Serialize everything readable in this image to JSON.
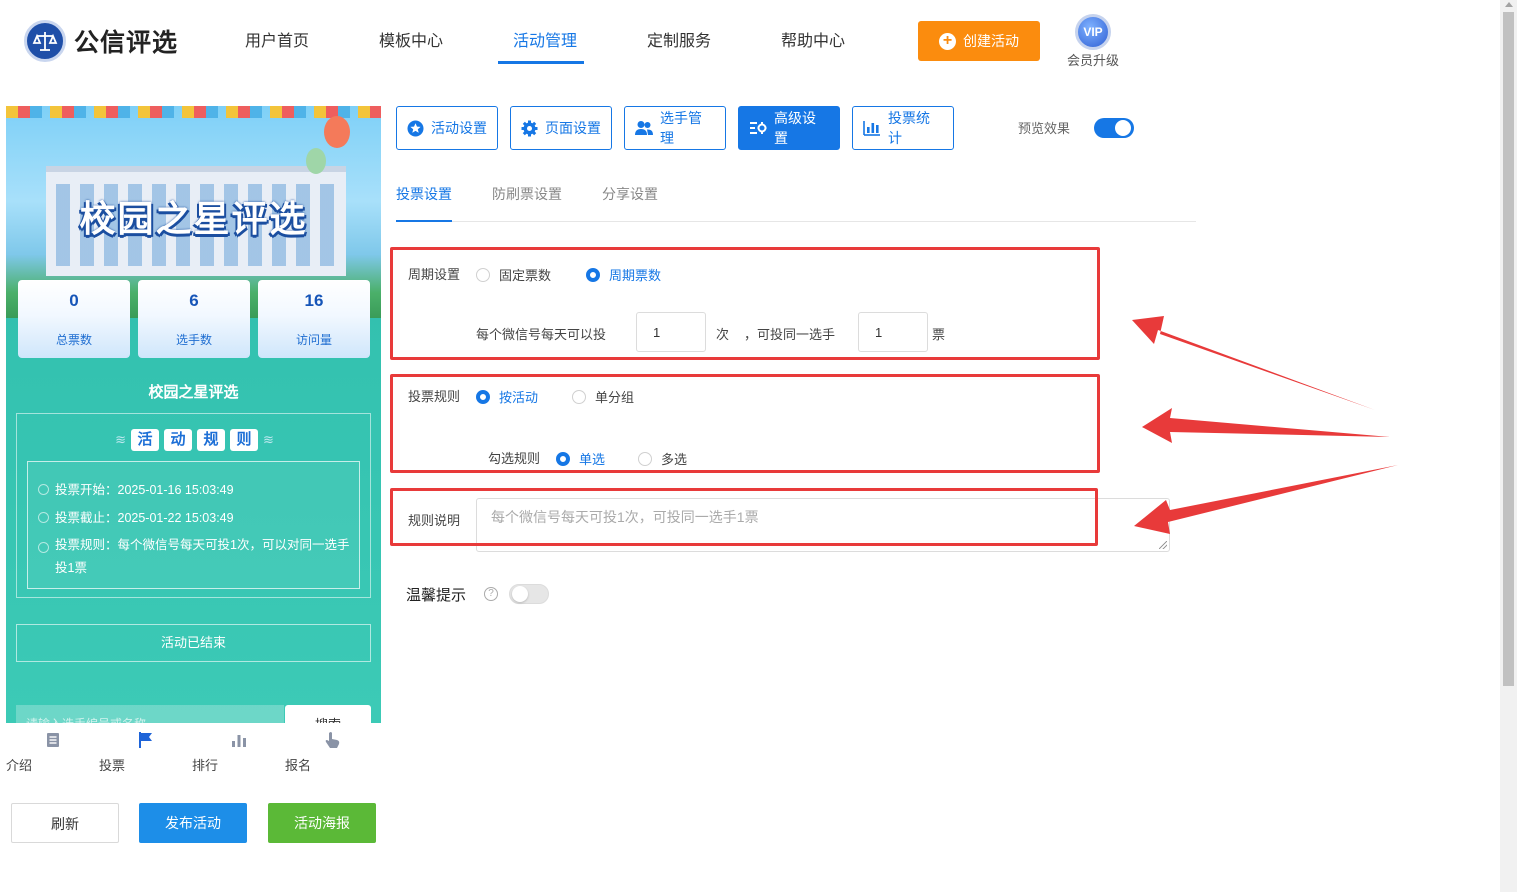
{
  "brand": {
    "name": "公信评选"
  },
  "nav": {
    "items": [
      {
        "label": "用户首页"
      },
      {
        "label": "模板中心"
      },
      {
        "label": "活动管理"
      },
      {
        "label": "定制服务"
      },
      {
        "label": "帮助中心"
      }
    ],
    "active": "活动管理",
    "create_button": "创建活动",
    "vip_badge": "VIP",
    "vip_label": "会员升级"
  },
  "preview": {
    "banner_title": "校园之星评选",
    "stats": [
      {
        "value": "0",
        "label": "总票数"
      },
      {
        "value": "6",
        "label": "选手数"
      },
      {
        "value": "16",
        "label": "访问量"
      }
    ],
    "activity_name": "校园之星评选",
    "rules_heading": [
      "活",
      "动",
      "规",
      "则"
    ],
    "rules": [
      "投票开始：2025-01-16 15:03:49",
      "投票截止：2025-01-22 15:03:49",
      "投票规则：每个微信号每天可投1次，可以对同一选手投1票"
    ],
    "ended_label": "活动已结束",
    "search_placeholder": "请输入选手编号或名称",
    "search_button": "搜索",
    "tabbar": [
      {
        "label": "介绍",
        "icon": "document-icon"
      },
      {
        "label": "投票",
        "icon": "flag-icon"
      },
      {
        "label": "排行",
        "icon": "bar-chart-icon"
      },
      {
        "label": "报名",
        "icon": "hand-pointer-icon"
      }
    ],
    "tabbar_active": "投票",
    "buttons": {
      "refresh": "刷新",
      "publish": "发布活动",
      "poster": "活动海报"
    }
  },
  "settings": {
    "top_tabs": [
      {
        "label": "活动设置",
        "icon": "star-icon"
      },
      {
        "label": "页面设置",
        "icon": "gear-icon"
      },
      {
        "label": "选手管理",
        "icon": "users-icon"
      },
      {
        "label": "高级设置",
        "icon": "sliders-icon"
      },
      {
        "label": "投票统计",
        "icon": "bar-chart-icon"
      }
    ],
    "active_top_tab": "高级设置",
    "preview_label": "预览效果",
    "preview_on": true,
    "sub_tabs": [
      "投票设置",
      "防刷票设置",
      "分享设置"
    ],
    "active_sub_tab": "投票设置",
    "cycle": {
      "label": "周期设置",
      "options": [
        "固定票数",
        "周期票数"
      ],
      "selected": "周期票数",
      "prefix": "每个微信号每天可以投",
      "times_value": "1",
      "times_unit": "次",
      "middle": "，可投同一选手",
      "votes_value": "1",
      "votes_unit": "票"
    },
    "vote_rule": {
      "label": "投票规则",
      "options": [
        "按活动",
        "单分组"
      ],
      "selected": "按活动",
      "check_label": "勾选规则",
      "check_options": [
        "单选",
        "多选"
      ],
      "check_selected": "单选"
    },
    "rule_desc": {
      "label": "规则说明",
      "placeholder": "每个微信号每天可投1次，可投同一选手1票"
    },
    "tip": {
      "label": "温馨提示",
      "on": false,
      "help_icon": "question-circle-icon"
    }
  },
  "colors": {
    "primary": "#1677e5",
    "orange": "#fb8c0e",
    "green": "#5bb937",
    "annotation_red": "#e83a3a"
  }
}
